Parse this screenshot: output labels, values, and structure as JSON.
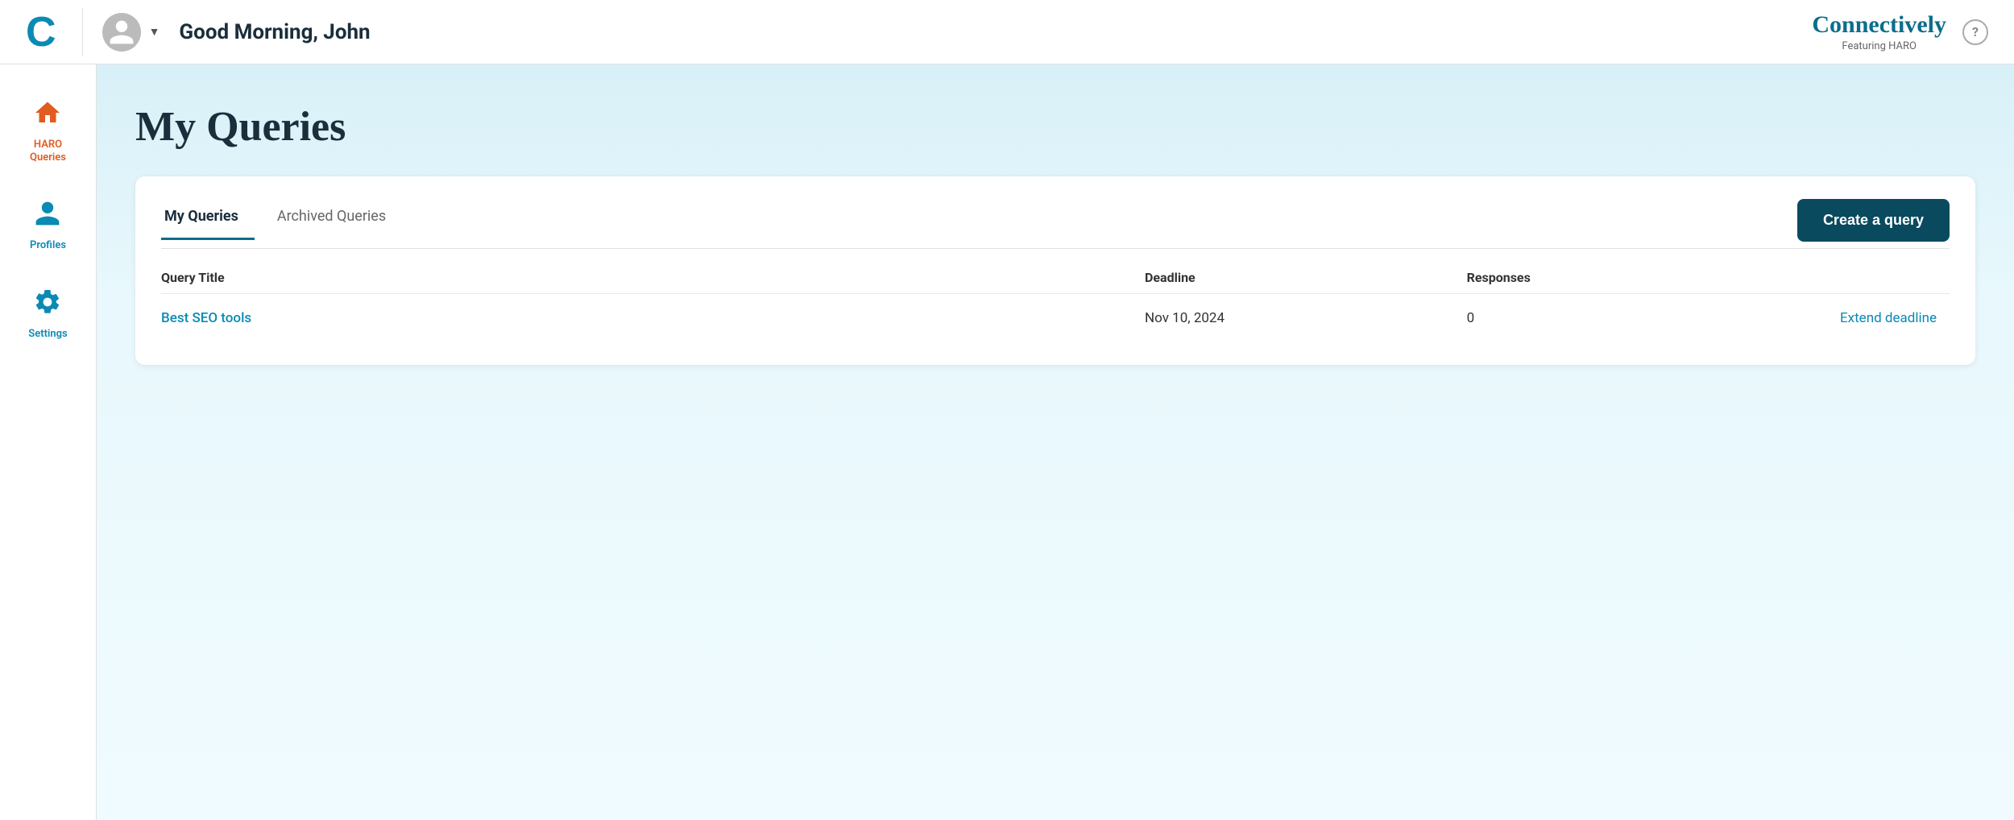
{
  "header": {
    "logo": "C",
    "greeting": "Good Morning, John",
    "brand": {
      "name": "Connectively",
      "subtitle": "Featuring HARO"
    },
    "help_label": "?"
  },
  "sidebar": {
    "items": [
      {
        "id": "haro-queries",
        "label": "HARO\nQueries",
        "icon": "home",
        "color": "orange"
      },
      {
        "id": "profiles",
        "label": "Profiles",
        "icon": "person",
        "color": "teal"
      },
      {
        "id": "settings",
        "label": "Settings",
        "icon": "gear",
        "color": "teal"
      }
    ]
  },
  "page": {
    "title": "My Queries",
    "tabs": [
      {
        "id": "my-queries",
        "label": "My Queries",
        "active": true
      },
      {
        "id": "archived-queries",
        "label": "Archived Queries",
        "active": false
      }
    ],
    "create_button": "Create a query",
    "table": {
      "columns": [
        {
          "id": "title",
          "label": "Query Title"
        },
        {
          "id": "deadline",
          "label": "Deadline"
        },
        {
          "id": "responses",
          "label": "Responses"
        },
        {
          "id": "action",
          "label": ""
        }
      ],
      "rows": [
        {
          "title": "Best SEO tools",
          "deadline": "Nov 10, 2024",
          "responses": "0",
          "action": "Extend deadline"
        }
      ]
    }
  }
}
